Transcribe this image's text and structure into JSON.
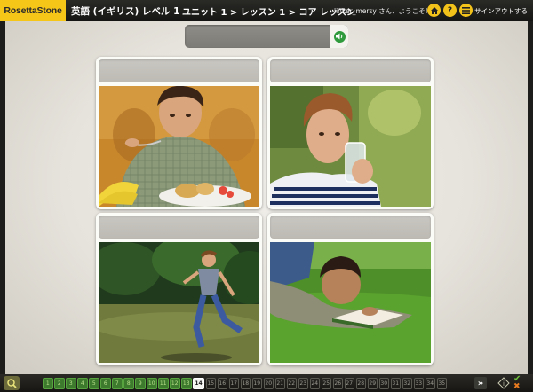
{
  "header": {
    "brand": "RosettaStone",
    "course": "英語 (イギリス) レベル 1",
    "breadcrumb": "ユニット 1 > レッスン 1 > コア レッスン",
    "welcome": "linker_mersy さん、ようこそ!",
    "signout": "サインアウトする",
    "home_icon": "home-icon",
    "help_label": "?",
    "menu_icon": "menu-icon",
    "accent_color": "#f5c518"
  },
  "prompt": {
    "text": "",
    "audio_icon": "speaker-icon"
  },
  "cards": [
    {
      "id": "eating",
      "label": ""
    },
    {
      "id": "drinking",
      "label": ""
    },
    {
      "id": "running",
      "label": ""
    },
    {
      "id": "reading",
      "label": ""
    }
  ],
  "footer": {
    "nav_icon": "screen-nav-icon",
    "current": 14,
    "tiles": [
      {
        "n": "1",
        "state": "done"
      },
      {
        "n": "2",
        "state": "done"
      },
      {
        "n": "3",
        "state": "done"
      },
      {
        "n": "4",
        "state": "done"
      },
      {
        "n": "5",
        "state": "done"
      },
      {
        "n": "6",
        "state": "done"
      },
      {
        "n": "7",
        "state": "done"
      },
      {
        "n": "8",
        "state": "done"
      },
      {
        "n": "9",
        "state": "done"
      },
      {
        "n": "10",
        "state": "done"
      },
      {
        "n": "11",
        "state": "done"
      },
      {
        "n": "12",
        "state": "done"
      },
      {
        "n": "13",
        "state": "done"
      },
      {
        "n": "14",
        "state": "current"
      },
      {
        "n": "15",
        "state": "todo"
      },
      {
        "n": "16",
        "state": "todo"
      },
      {
        "n": "17",
        "state": "todo"
      },
      {
        "n": "18",
        "state": "todo"
      },
      {
        "n": "19",
        "state": "todo"
      },
      {
        "n": "20",
        "state": "todo"
      },
      {
        "n": "21",
        "state": "todo"
      },
      {
        "n": "22",
        "state": "todo"
      },
      {
        "n": "23",
        "state": "todo"
      },
      {
        "n": "24",
        "state": "todo"
      },
      {
        "n": "25",
        "state": "todo"
      },
      {
        "n": "26",
        "state": "todo"
      },
      {
        "n": "27",
        "state": "todo"
      },
      {
        "n": "28",
        "state": "todo"
      },
      {
        "n": "29",
        "state": "todo"
      },
      {
        "n": "30",
        "state": "todo"
      },
      {
        "n": "31",
        "state": "todo"
      },
      {
        "n": "32",
        "state": "todo"
      },
      {
        "n": "33",
        "state": "todo"
      },
      {
        "n": "34",
        "state": "todo"
      },
      {
        "n": "35",
        "state": "todo"
      }
    ],
    "next_label": "»",
    "info_icon": "info-icon",
    "correct_icon": "check-icon",
    "incorrect_icon": "cross-icon",
    "done_color": "#3d7a2e"
  }
}
